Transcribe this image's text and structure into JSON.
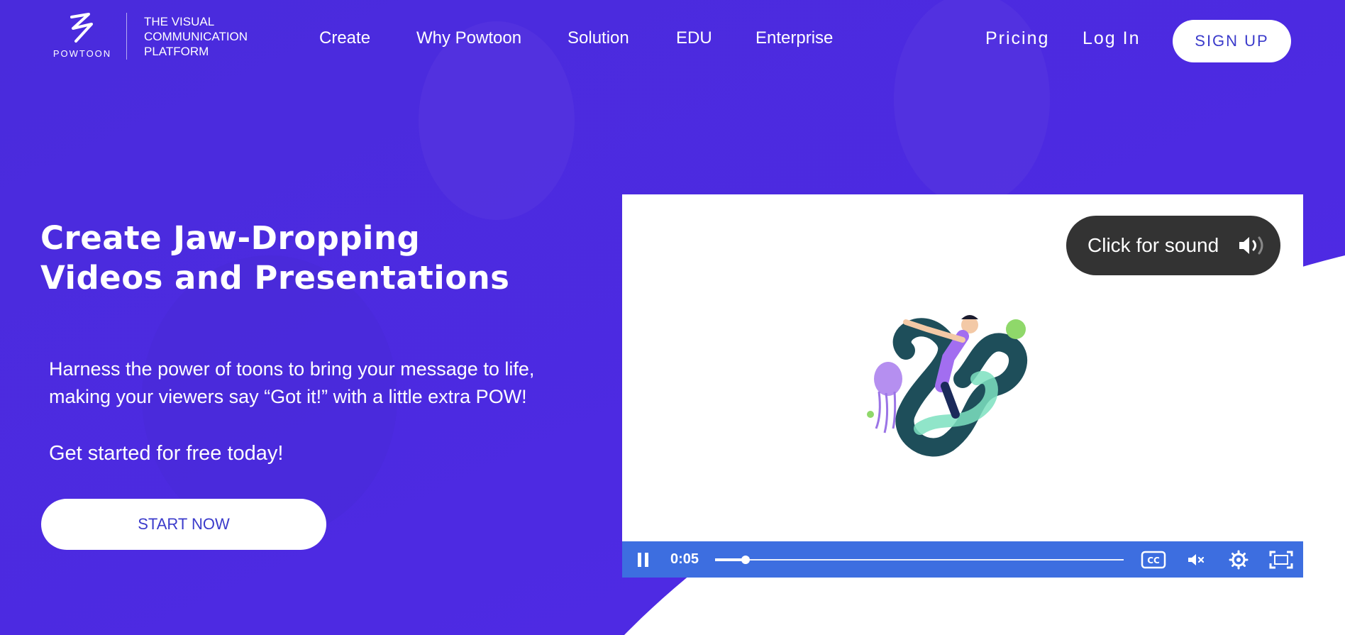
{
  "colors": {
    "hero_purple": "#4b2ae0",
    "video_controls": "#3d6ee0",
    "button_text": "#3b3bcb",
    "sound_pill": "#333333"
  },
  "header": {
    "logo_word": "POWTOON",
    "tagline": [
      "THE VISUAL",
      "COMMUNICATION",
      "PLATFORM"
    ],
    "nav": [
      "Create",
      "Why Powtoon",
      "Solution",
      "EDU",
      "Enterprise"
    ],
    "pricing": "Pricing",
    "login": "Log In",
    "signup": "SIGN UP"
  },
  "hero": {
    "title_lines": [
      "Create Jaw-Dropping",
      "Videos and Presentations"
    ],
    "description": "Harness the power of toons to bring your message to life, making your viewers say “Got it!” with a little extra POW!",
    "cta_text": "Get started for free today!",
    "start_button": "START NOW"
  },
  "video": {
    "sound_prompt": "Click for sound",
    "time": "0:05",
    "progress": 0.075,
    "icons": [
      "pause-icon",
      "cc-icon",
      "mute-icon",
      "settings-icon",
      "fullscreen-icon",
      "speaker-icon"
    ]
  }
}
